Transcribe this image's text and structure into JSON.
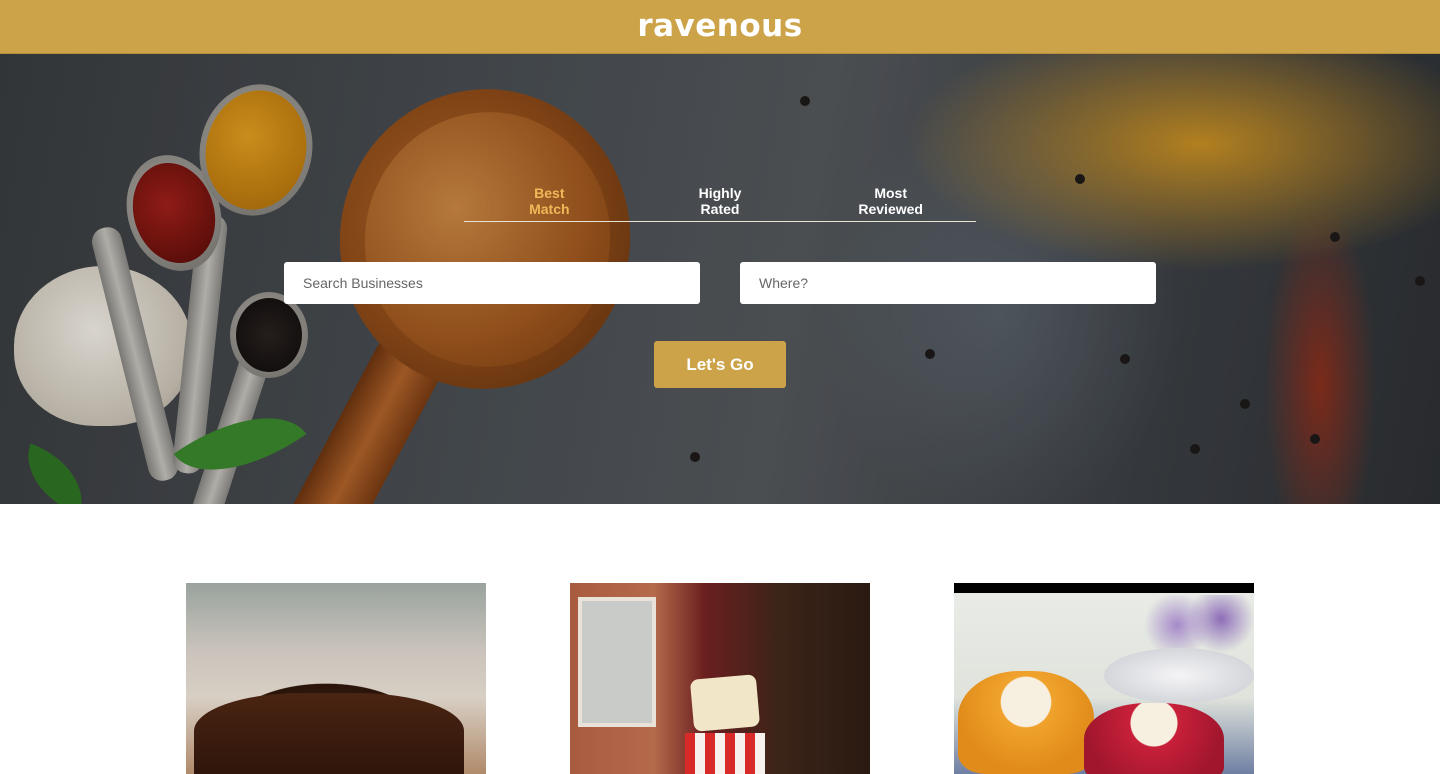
{
  "header": {
    "brand": "ravenous",
    "brand_color": "#cca349"
  },
  "search": {
    "sort_options": [
      {
        "line1": "Best",
        "line2": "Match",
        "active": true
      },
      {
        "line1": "Highly",
        "line2": "Rated",
        "active": false
      },
      {
        "line1": "Most",
        "line2": "Reviewed",
        "active": false
      }
    ],
    "business_placeholder": "Search Businesses",
    "location_placeholder": "Where?",
    "submit_label": "Let's Go",
    "active_tab_color": "#f0b859"
  },
  "hero": {
    "image": "spices-and-wooden-spoon-photo"
  },
  "results": {
    "cards": [
      {
        "image": "chocolate-cake-photo"
      },
      {
        "image": "birthday-party-table-photo"
      },
      {
        "image": "bundt-cakes-photo"
      }
    ]
  }
}
